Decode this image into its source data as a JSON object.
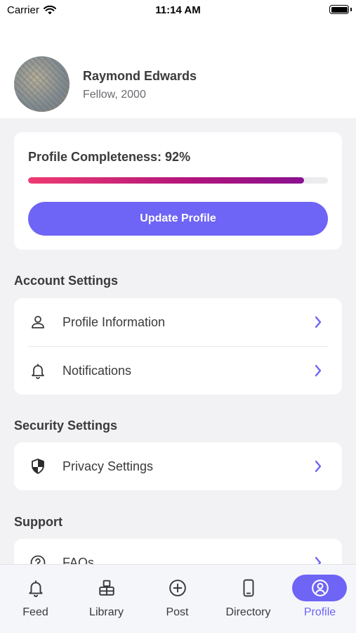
{
  "status_bar": {
    "carrier": "Carrier",
    "time": "11:14 AM"
  },
  "profile": {
    "name": "Raymond Edwards",
    "subtitle": "Fellow, 2000"
  },
  "completeness": {
    "label": "Profile Completeness: 92%",
    "percent": 92,
    "button_label": "Update Profile"
  },
  "sections": {
    "account": {
      "title": "Account Settings",
      "items": [
        {
          "label": "Profile Information",
          "icon": "person-icon"
        },
        {
          "label": "Notifications",
          "icon": "bell-icon"
        }
      ]
    },
    "security": {
      "title": "Security Settings",
      "items": [
        {
          "label": "Privacy Settings",
          "icon": "shield-icon"
        }
      ]
    },
    "support": {
      "title": "Support",
      "items": [
        {
          "label": "FAQs",
          "icon": "question-circle-icon"
        }
      ]
    }
  },
  "tabs": [
    {
      "label": "Feed",
      "icon": "bell-icon",
      "active": false
    },
    {
      "label": "Library",
      "icon": "library-icon",
      "active": false
    },
    {
      "label": "Post",
      "icon": "plus-circle-icon",
      "active": false
    },
    {
      "label": "Directory",
      "icon": "phone-icon",
      "active": false
    },
    {
      "label": "Profile",
      "icon": "user-circle-icon",
      "active": true
    }
  ],
  "colors": {
    "accent": "#6e64f5",
    "progress_start": "#ef3a72",
    "progress_end": "#8a1190",
    "chevron": "#6e64f5"
  }
}
